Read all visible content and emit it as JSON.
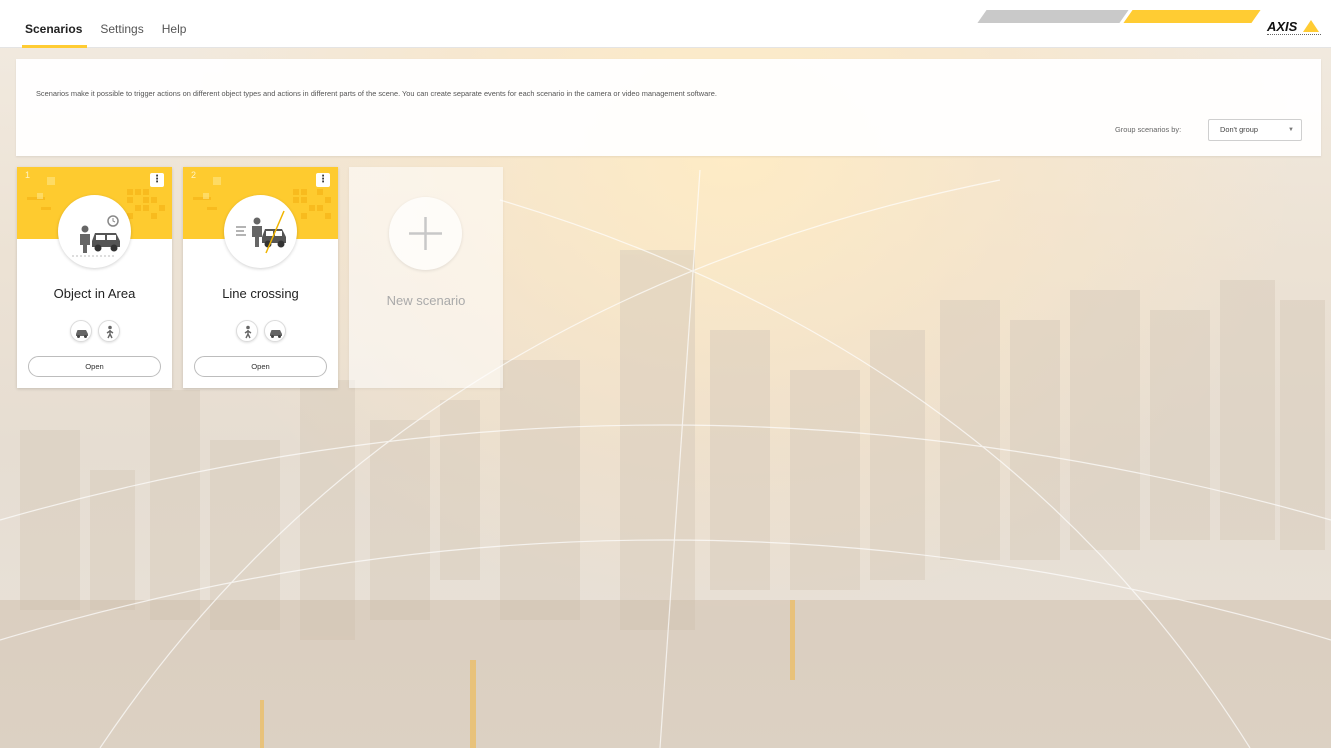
{
  "nav": {
    "tabs": [
      {
        "label": "Scenarios",
        "active": true
      },
      {
        "label": "Settings",
        "active": false
      },
      {
        "label": "Help",
        "active": false
      }
    ],
    "logo": {
      "text": "AXIS",
      "subtext": "COMMUNICATIONS"
    },
    "accent_color": "#ffcc33"
  },
  "info": {
    "description": "Scenarios make it possible to trigger actions on different object types and actions in different parts of the scene. You can create separate events for each scenario in the camera or video management software.",
    "group_label": "Group scenarios by:",
    "group_value": "Don't group"
  },
  "scenarios": [
    {
      "id": "1",
      "title": "Object in Area",
      "icon": "object-in-area-icon",
      "object_types": [
        "vehicle-icon",
        "human-icon"
      ],
      "open_label": "Open"
    },
    {
      "id": "2",
      "title": "Line crossing",
      "icon": "line-crossing-icon",
      "object_types": [
        "human-icon",
        "vehicle-icon"
      ],
      "open_label": "Open"
    }
  ],
  "new_scenario": {
    "label": "New scenario",
    "icon": "plus-icon"
  }
}
